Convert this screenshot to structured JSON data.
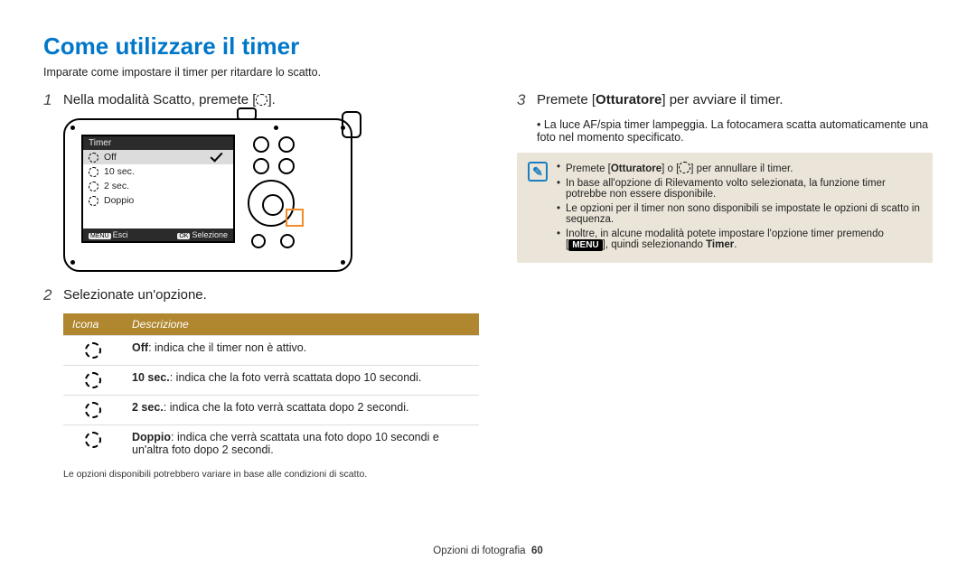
{
  "title": "Come utilizzare il timer",
  "subtitle": "Imparate come impostare il timer per ritardare lo scatto.",
  "steps": {
    "s1_num": "1",
    "s1_pre": "Nella modalità Scatto, premete [",
    "s1_post": "].",
    "s2_num": "2",
    "s2_text": "Selezionate un'opzione.",
    "s3_num": "3",
    "s3_pre": "Premete [",
    "s3_bold": "Otturatore",
    "s3_post": "] per avviare il timer.",
    "s3_sub": "La luce AF/spia timer lampeggia. La fotocamera scatta automaticamente una foto nel momento specificato."
  },
  "lcd": {
    "header": "Timer",
    "r1": "Off",
    "r2": "10 sec.",
    "r3": "2 sec.",
    "r4": "Doppio",
    "ft_menu": "MENU",
    "ft_esci": "Esci",
    "ft_ok": "OK",
    "ft_sel": "Selezione"
  },
  "table_hdr": {
    "icon": "Icona",
    "desc": "Descrizione"
  },
  "rows": {
    "r1_b": "Off",
    "r1_t": ": indica che il timer non è attivo.",
    "r2_b": "10 sec.",
    "r2_t": ": indica che la foto verrà scattata dopo 10 secondi.",
    "r3_b": "2 sec.",
    "r3_t": ": indica che la foto verrà scattata dopo 2 secondi.",
    "r4_b": "Doppio",
    "r4_t": ": indica che verrà scattata una foto dopo 10 secondi e un'altra foto dopo 2 secondi."
  },
  "fine_note": "Le opzioni disponibili potrebbero variare in base alle condizioni di scatto.",
  "info": {
    "n1_pre": "Premete [",
    "n1_b": "Otturatore",
    "n1_mid": "] o [",
    "n1_post": "] per annullare il timer.",
    "n2": "In base all'opzione di Rilevamento volto selezionata, la funzione timer potrebbe non essere disponibile.",
    "n3": "Le opzioni per il timer non sono disponibili se impostate le opzioni di scatto in sequenza.",
    "n4_pre": "Inoltre, in alcune modalità potete impostare l'opzione timer premendo [",
    "n4_menu": "MENU",
    "n4_mid": "], quindi selezionando ",
    "n4_b": "Timer",
    "n4_post": "."
  },
  "footer_text": "Opzioni di fotografia",
  "footer_page": "60"
}
